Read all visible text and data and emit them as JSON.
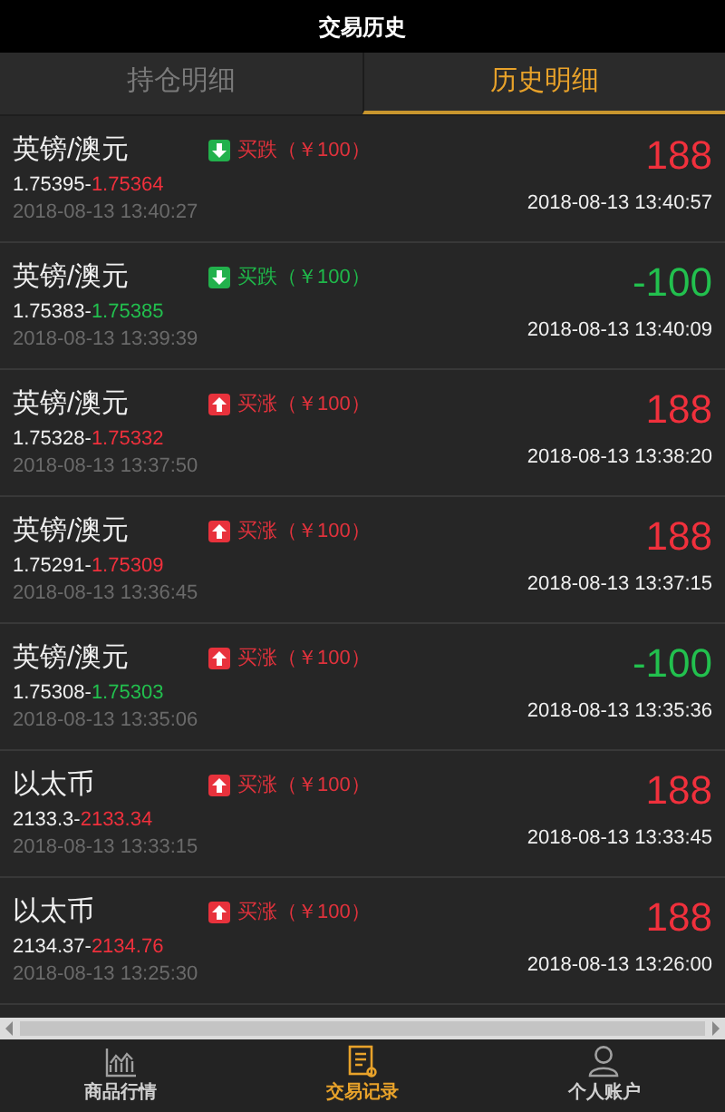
{
  "title": "交易历史",
  "tabs": [
    {
      "label": "持仓明细",
      "selected": false
    },
    {
      "label": "历史明细",
      "selected": true
    }
  ],
  "records": [
    {
      "name": "英镑/澳元",
      "order": {
        "kind": "down",
        "label": "买跌（￥100）",
        "color": "#e0323c"
      },
      "open": "1.75395",
      "sep": "-",
      "close": "1.75364",
      "color": "#f0303c",
      "open_time": "2018-08-13 13:40:27",
      "profit": "188",
      "close_time": "2018-08-13 13:40:57"
    },
    {
      "name": "英镑/澳元",
      "order": {
        "kind": "down",
        "label": "买跌（￥100）",
        "color": "#1fb84a"
      },
      "open": "1.75383",
      "sep": "-",
      "close": "1.75385",
      "color": "#22c04e",
      "open_time": "2018-08-13 13:39:39",
      "profit": "-100",
      "close_time": "2018-08-13 13:40:09"
    },
    {
      "name": "英镑/澳元",
      "order": {
        "kind": "up",
        "label": "买涨（￥100）",
        "color": "#e0323c"
      },
      "open": "1.75328",
      "sep": "-",
      "close": "1.75332",
      "color": "#f0303c",
      "open_time": "2018-08-13 13:37:50",
      "profit": "188",
      "close_time": "2018-08-13 13:38:20"
    },
    {
      "name": "英镑/澳元",
      "order": {
        "kind": "up",
        "label": "买涨（￥100）",
        "color": "#e0323c"
      },
      "open": "1.75291",
      "sep": "-",
      "close": "1.75309",
      "color": "#f0303c",
      "open_time": "2018-08-13 13:36:45",
      "profit": "188",
      "close_time": "2018-08-13 13:37:15"
    },
    {
      "name": "英镑/澳元",
      "order": {
        "kind": "up",
        "label": "买涨（￥100）",
        "color": "#e0323c"
      },
      "open": "1.75308",
      "sep": "-",
      "close": "1.75303",
      "color": "#22c04e",
      "open_time": "2018-08-13 13:35:06",
      "profit": "-100",
      "close_time": "2018-08-13 13:35:36"
    },
    {
      "name": "以太币",
      "order": {
        "kind": "up",
        "label": "买涨（￥100）",
        "color": "#e0323c"
      },
      "open": "2133.3",
      "sep": "-",
      "close": "2133.34",
      "color": "#f0303c",
      "open_time": "2018-08-13 13:33:15",
      "profit": "188",
      "close_time": "2018-08-13 13:33:45"
    },
    {
      "name": "以太币",
      "order": {
        "kind": "up",
        "label": "买涨（￥100）",
        "color": "#e0323c"
      },
      "open": "2134.37",
      "sep": "-",
      "close": "2134.76",
      "color": "#f0303c",
      "open_time": "2018-08-13 13:25:30",
      "profit": "188",
      "close_time": "2018-08-13 13:26:00"
    }
  ],
  "nav": [
    {
      "kind": "chart",
      "label": "商品行情",
      "selected": false
    },
    {
      "kind": "record",
      "label": "交易记录",
      "selected": true
    },
    {
      "kind": "user",
      "label": "个人账户",
      "selected": false
    }
  ]
}
